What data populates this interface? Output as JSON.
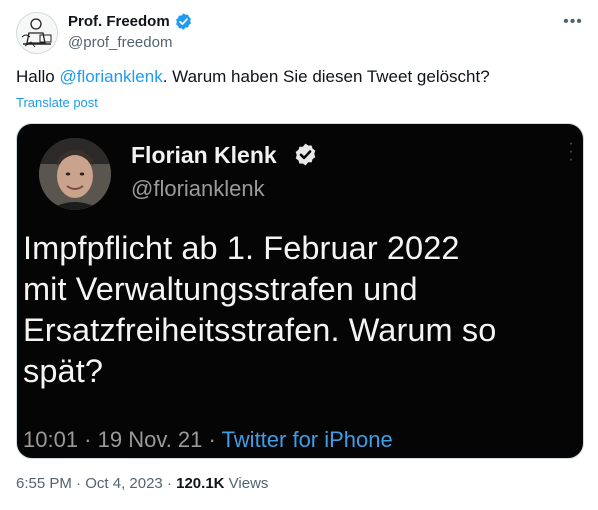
{
  "author": {
    "name": "Prof. Freedom",
    "handle": "@prof_freedom"
  },
  "tweet": {
    "text_prefix": "Hallo ",
    "mention": "@florianklenk",
    "text_suffix": ". Warum haben Sie diesen Tweet gelöscht?",
    "translate_label": "Translate post"
  },
  "embedded_screenshot": {
    "name": "Florian Klenk",
    "handle": "@florianklenk",
    "text_lines": [
      "Impfpflicht ab 1. Februar 2022",
      "mit Verwaltungsstrafen und",
      "Ersatzfreiheitsstrafen. Warum so",
      "spät?"
    ],
    "time": "10:01",
    "date": "19 Nov. 21",
    "source": "Twitter for iPhone",
    "separator": " · "
  },
  "footer": {
    "time": "6:55 PM",
    "date": "Oct 4, 2023",
    "views_count": "120.1K",
    "views_label": "Views",
    "separator": " · "
  },
  "icons": {
    "verified": "verified-badge-icon",
    "more": "more-options-icon"
  },
  "colors": {
    "accent": "#1d9bf0",
    "text_primary": "#0f1419",
    "text_secondary": "#536471",
    "media_background": "#050505"
  }
}
